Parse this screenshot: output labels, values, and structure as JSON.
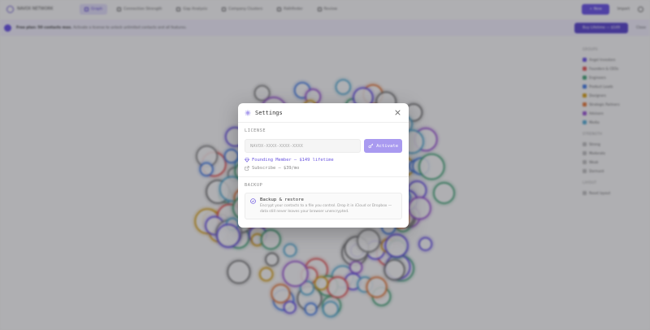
{
  "app": {
    "brand": "NAVOX NETWORK",
    "nav": [
      {
        "label": "Graph",
        "active": true
      },
      {
        "label": "Connection Strength",
        "active": false
      },
      {
        "label": "Gap Analysis",
        "active": false
      },
      {
        "label": "Company Clusters",
        "active": false
      },
      {
        "label": "Pathfinder",
        "active": false
      },
      {
        "label": "Review",
        "active": false
      }
    ],
    "new_button": "+ New",
    "import_button": "Import",
    "banner": {
      "bold": "Free plan: 50 contacts max.",
      "text": "Activate a license to unlock unlimited contacts and all features.",
      "button": "Buy Lifetime — $149",
      "close": "Close"
    },
    "legend": {
      "groups_head": "GROUPS",
      "groups": [
        {
          "label": "Angel Investors",
          "color": "#6a55e0"
        },
        {
          "label": "Founders & CEOs",
          "color": "#e05a5a"
        },
        {
          "label": "Engineers",
          "color": "#4aa37a"
        },
        {
          "label": "Product Leads",
          "color": "#4a7ee0"
        },
        {
          "label": "Designers",
          "color": "#d4a020"
        },
        {
          "label": "Strategic Partners",
          "color": "#e07a40"
        },
        {
          "label": "Advisors",
          "color": "#9a5ad0"
        },
        {
          "label": "Media",
          "color": "#5aaad0"
        }
      ],
      "strength_head": "STRENGTH",
      "strength": [
        "Strong",
        "Moderate",
        "Weak",
        "Dormant"
      ],
      "layout_head": "LAYOUT",
      "layout": [
        "Reset layout"
      ]
    }
  },
  "modal": {
    "title": "Settings",
    "license": {
      "label": "LICENSE",
      "placeholder": "NAVOX-XXXX-XXXX-XXXX",
      "activate_label": "Activate",
      "founding_text": "Founding Member — $149 lifetime",
      "subscribe_text": "Subscribe — $39/mo"
    },
    "backup": {
      "label": "BACKUP",
      "title": "Backup & restore",
      "description": "Encrypt your contacts to a file you control. Drop it in iCloud or Dropbox — data still never leaves your browser unencrypted."
    }
  },
  "colors": {
    "accent": "#6a55e0",
    "activate_bg": "#a99af0"
  }
}
